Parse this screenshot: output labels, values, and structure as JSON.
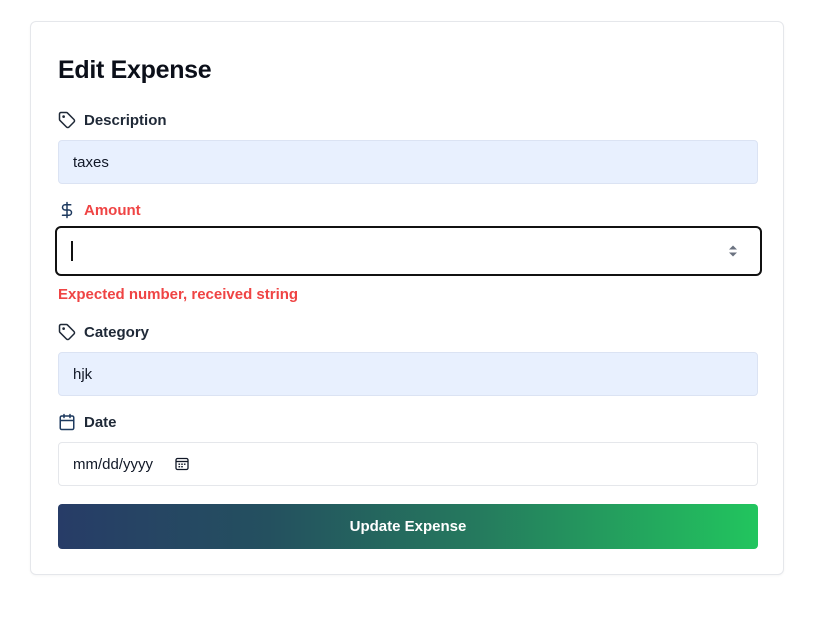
{
  "form": {
    "title": "Edit Expense",
    "description": {
      "label": "Description",
      "value": "taxes",
      "icon": "tag-icon"
    },
    "amount": {
      "label": "Amount",
      "value": "",
      "icon": "dollar-icon",
      "error": "Expected number, received string"
    },
    "category": {
      "label": "Category",
      "value": "hjk",
      "icon": "tag-icon"
    },
    "date": {
      "label": "Date",
      "placeholder": "mm/dd/yyyy",
      "icon": "calendar-icon"
    },
    "submit_label": "Update Expense"
  },
  "colors": {
    "error": "#ef4444",
    "filled_bg": "#e8f0fe",
    "button_gradient_start": "#273c67",
    "button_gradient_end": "#22c55e"
  }
}
